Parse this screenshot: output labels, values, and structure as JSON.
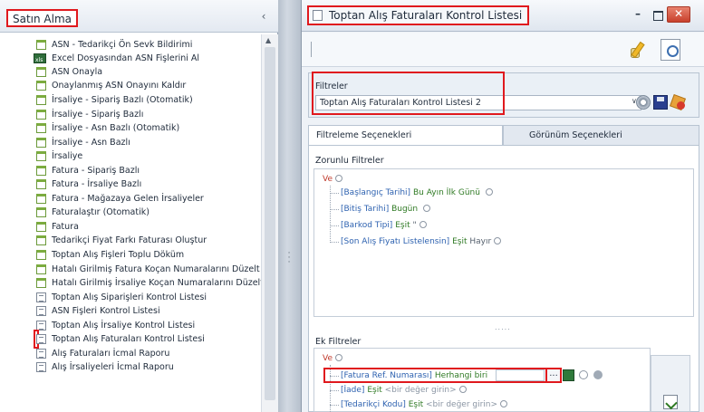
{
  "left_panel": {
    "title": "Satın Alma",
    "collapse_glyph": "‹",
    "items": [
      {
        "label": "ASN - Tedarikçi Ön Sevk Bildirimi",
        "icon": "form-icon"
      },
      {
        "label": "Excel Dosyasından ASN Fişlerini Al",
        "icon": "excel-icon"
      },
      {
        "label": "ASN Onayla",
        "icon": "form-icon"
      },
      {
        "label": "Onaylanmış ASN Onayını Kaldır",
        "icon": "form-icon"
      },
      {
        "label": "İrsaliye - Sipariş Bazlı (Otomatik)",
        "icon": "form-icon"
      },
      {
        "label": "İrsaliye - Sipariş Bazlı",
        "icon": "form-icon"
      },
      {
        "label": "İrsaliye - Asn Bazlı (Otomatik)",
        "icon": "form-icon"
      },
      {
        "label": "İrsaliye - Asn Bazlı",
        "icon": "form-icon"
      },
      {
        "label": "İrsaliye",
        "icon": "form-icon"
      },
      {
        "label": "Fatura - Sipariş Bazlı",
        "icon": "form-icon"
      },
      {
        "label": "Fatura - İrsaliye Bazlı",
        "icon": "form-icon"
      },
      {
        "label": "Fatura - Mağazaya Gelen İrsaliyeler",
        "icon": "form-icon"
      },
      {
        "label": "Faturalaştır (Otomatik)",
        "icon": "form-icon"
      },
      {
        "label": "Fatura",
        "icon": "form-icon"
      },
      {
        "label": "Tedarikçi Fiyat Farkı Faturası Oluştur",
        "icon": "form-icon"
      },
      {
        "label": "Toptan Alış Fişleri Toplu Döküm",
        "icon": "form-icon"
      },
      {
        "label": "Hatalı Girilmiş Fatura Koçan Numaralarını Düzelt",
        "icon": "form-icon"
      },
      {
        "label": "Hatalı Girilmiş İrsaliye Koçan Numaralarını Düzelt",
        "icon": "form-icon"
      },
      {
        "label": "Toptan Alış Siparişleri Kontrol Listesi",
        "icon": "report-icon"
      },
      {
        "label": "ASN Fişleri Kontrol Listesi",
        "icon": "report-icon"
      },
      {
        "label": "Toptan Alış İrsaliye Kontrol Listesi",
        "icon": "report-icon"
      },
      {
        "label": "Toptan Alış Faturaları Kontrol Listesi",
        "icon": "report-icon",
        "selected": true
      },
      {
        "label": "Alış Faturaları İcmal Raporu",
        "icon": "report-icon"
      },
      {
        "label": "Alış İrsaliyeleri İcmal Raporu",
        "icon": "report-icon"
      }
    ]
  },
  "window": {
    "title": "Toptan Alış Faturaları Kontrol Listesi",
    "min_glyph": "–",
    "close_glyph": "✕",
    "filters": {
      "label": "Filtreler",
      "selected": "Toptan Alış Faturaları Kontrol Listesi 2",
      "arrow": "∨"
    },
    "tabs": [
      {
        "label": "Filtreleme Seçenekleri",
        "active": true
      },
      {
        "label": "Görünüm Seçenekleri",
        "active": false
      }
    ],
    "mandatory": {
      "label": "Zorunlu Filtreler",
      "conjunction": "Ve",
      "rows": [
        {
          "field": "[Başlangıç Tarihi]",
          "op": "Bu Ayın İlk Günü",
          "value": ""
        },
        {
          "field": "[Bitiş Tarihi]",
          "op": "Bugün",
          "value": ""
        },
        {
          "field": "[Barkod Tipi]",
          "op": "Eşit",
          "value": "\""
        },
        {
          "field": "[Son Alış Fiyatı Listelensin]",
          "op": "Eşit",
          "value": "Hayır"
        }
      ]
    },
    "splitter_dots": ".....",
    "extra": {
      "label": "Ek Filtreler",
      "conjunction": "Ve",
      "rows": [
        {
          "field": "[Fatura Ref. Numarası]",
          "op": "Herhangi biri",
          "value": ""
        },
        {
          "field": "[İade]",
          "op": "Eşit",
          "value": "<bir değer girin>"
        },
        {
          "field": "[Tedarikçi Kodu]",
          "op": "Eşit",
          "value": "<bir değer girin>"
        }
      ],
      "ellipsis": "..."
    }
  }
}
